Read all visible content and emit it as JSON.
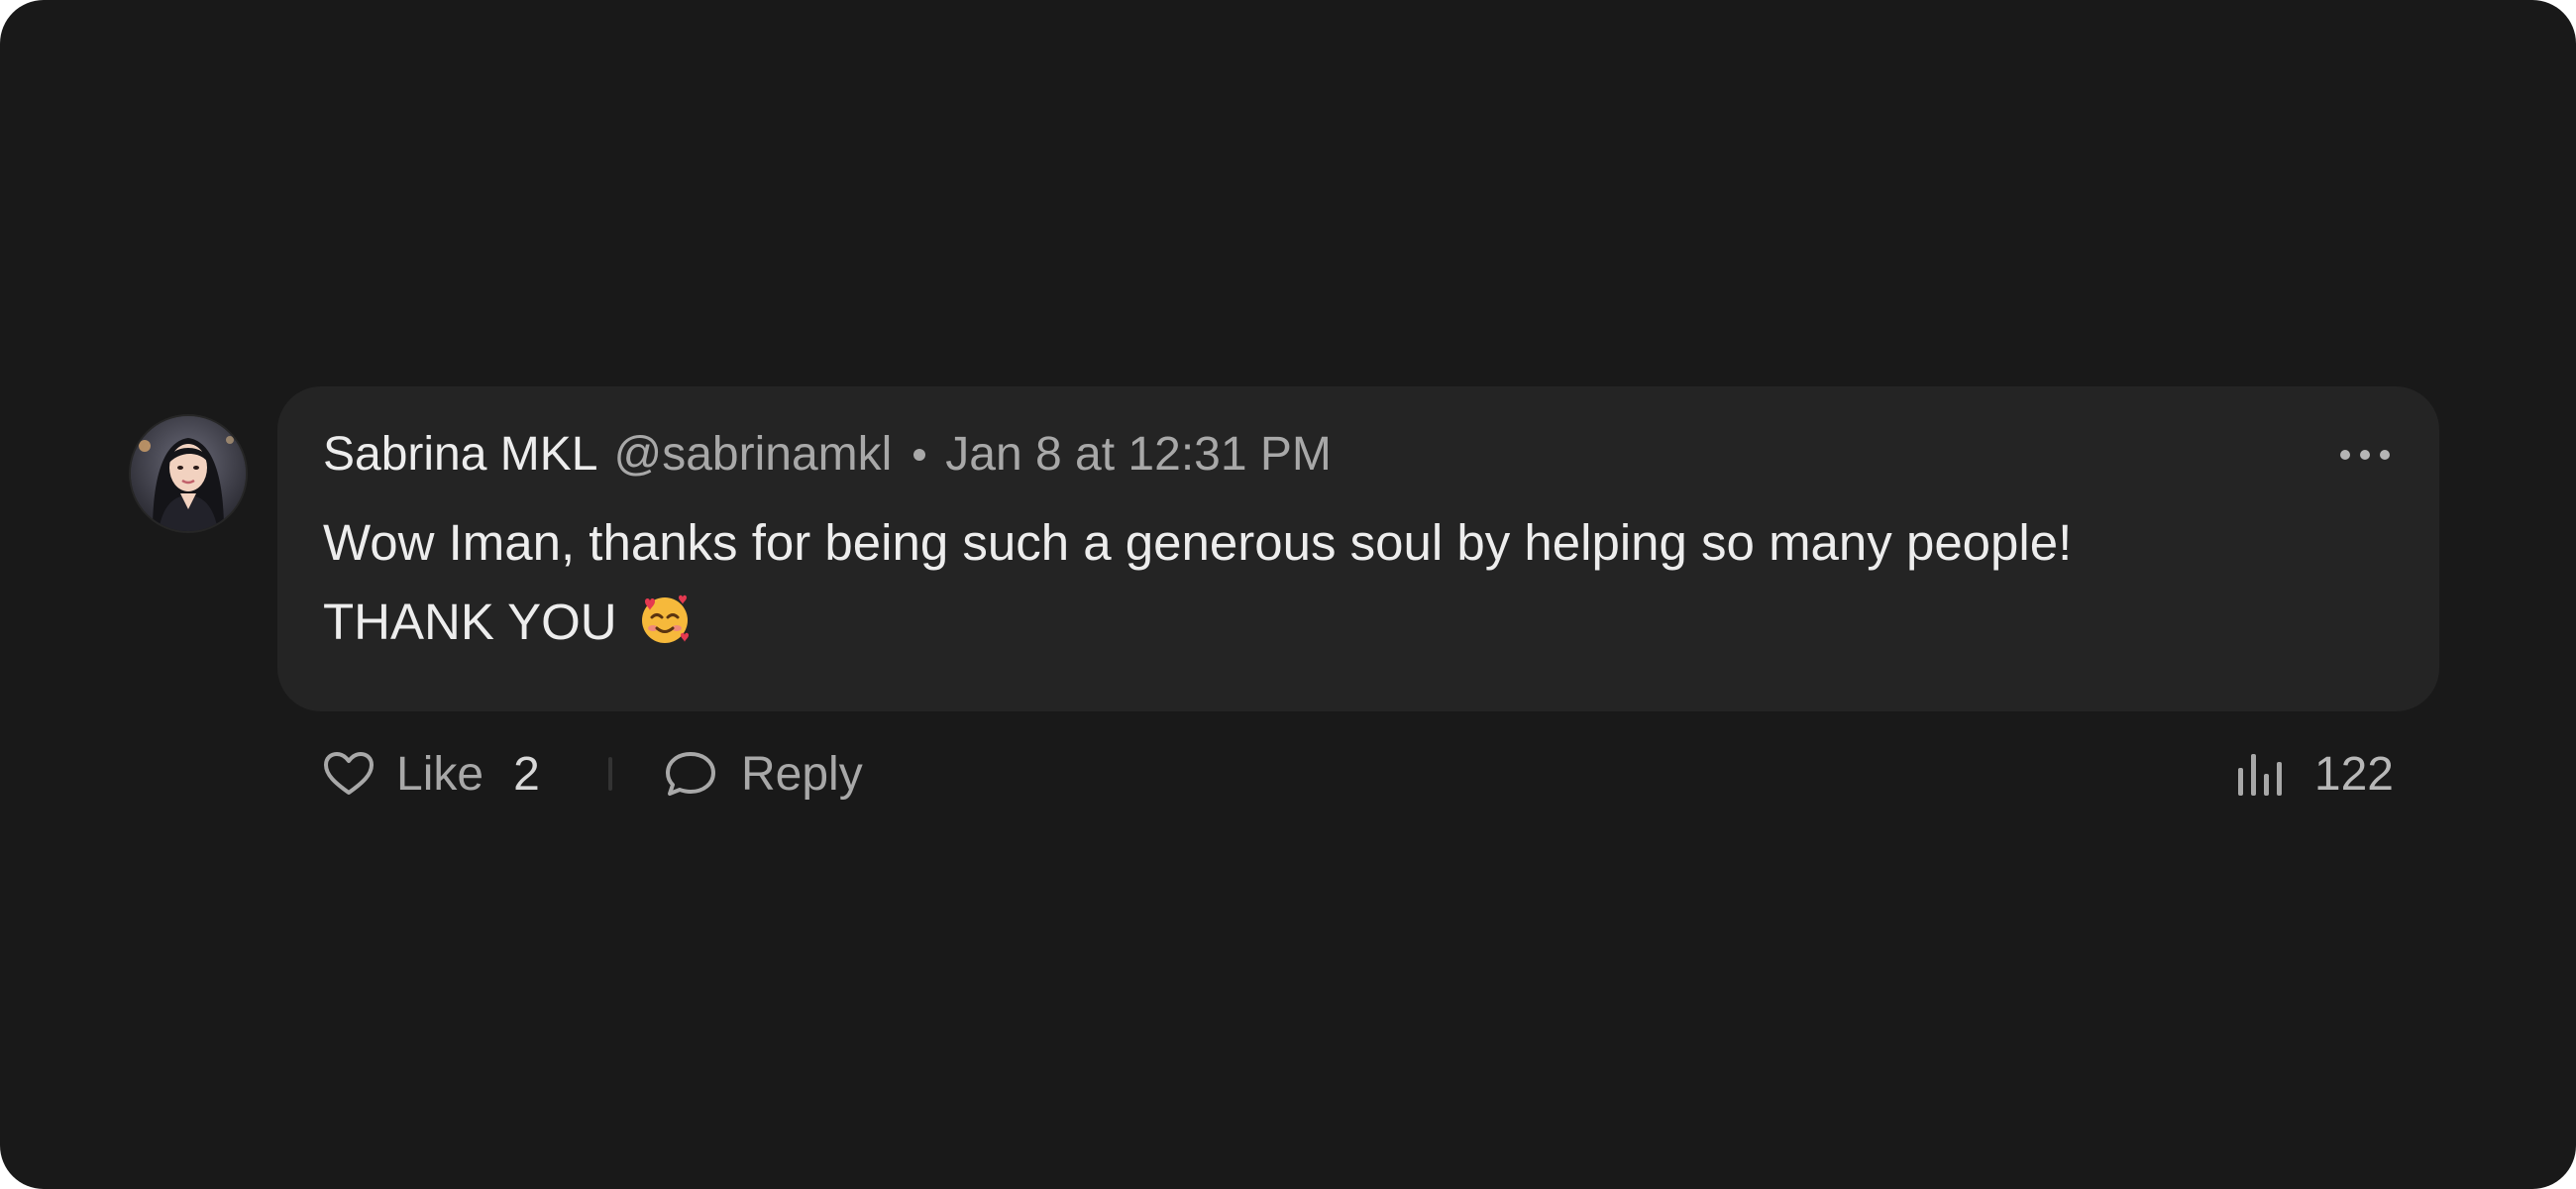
{
  "comment": {
    "author_name": "Sabrina MKL",
    "author_handle": "@sabrinamkl",
    "timestamp": "Jan 8 at 12:31 PM",
    "text_line1": "Wow Iman, thanks for being such a generous soul by helping so many people!",
    "text_line2": "THANK YOU",
    "emoji": "smiling-face-with-hearts",
    "avatar": "woman-portrait-avatar"
  },
  "actions": {
    "like_label": "Like",
    "like_count": "2",
    "reply_label": "Reply",
    "views_count": "122"
  },
  "icons": {
    "like": "heart-icon",
    "reply": "speech-bubble-icon",
    "views": "bar-chart-icon",
    "more": "more-dots-icon"
  },
  "colors": {
    "background": "#191919",
    "bubble": "#242424",
    "primary_text": "#ededed",
    "secondary_text": "#a8a8a8"
  }
}
